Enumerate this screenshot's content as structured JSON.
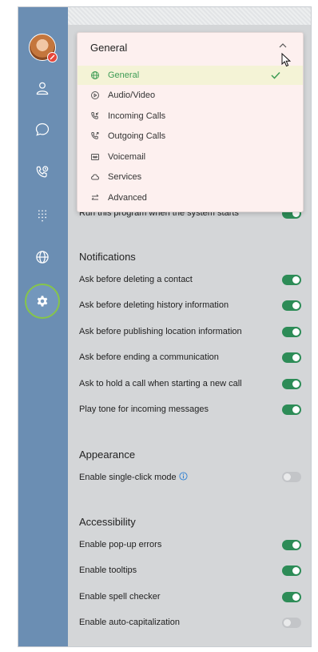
{
  "colors": {
    "sidebar": "#6b8eb3",
    "accent_green": "#2d8c57",
    "selected_text": "#3e9c55",
    "dropdown_bg": "#fdf0ef",
    "status_red": "#e5473b"
  },
  "sidebar": {
    "icons": [
      "contacts-icon",
      "chat-icon",
      "call-history-icon",
      "dialpad-icon",
      "globe-icon",
      "gear-icon"
    ]
  },
  "dropdown": {
    "selected": "General",
    "options": [
      {
        "label": "General",
        "icon": "globe-icon",
        "selected": true
      },
      {
        "label": "Audio/Video",
        "icon": "play-circle-icon",
        "selected": false
      },
      {
        "label": "Incoming Calls",
        "icon": "incoming-call-icon",
        "selected": false
      },
      {
        "label": "Outgoing Calls",
        "icon": "outgoing-call-icon",
        "selected": false
      },
      {
        "label": "Voicemail",
        "icon": "voicemail-icon",
        "selected": false
      },
      {
        "label": "Services",
        "icon": "cloud-icon",
        "selected": false
      },
      {
        "label": "Advanced",
        "icon": "arrows-icon",
        "selected": false
      }
    ]
  },
  "general": {
    "startup_label": "Run this program when the system starts",
    "startup_on": true
  },
  "notifications": {
    "title": "Notifications",
    "items": [
      {
        "label": "Ask before deleting a contact",
        "on": true
      },
      {
        "label": "Ask before deleting history information",
        "on": true
      },
      {
        "label": "Ask before publishing location information",
        "on": true
      },
      {
        "label": "Ask before ending a communication",
        "on": true
      },
      {
        "label": "Ask to hold a call when starting a new call",
        "on": true
      },
      {
        "label": "Play tone for incoming messages",
        "on": true
      }
    ]
  },
  "appearance": {
    "title": "Appearance",
    "items": [
      {
        "label": "Enable single-click mode",
        "on": false
      }
    ]
  },
  "accessibility": {
    "title": "Accessibility",
    "items": [
      {
        "label": "Enable pop-up errors",
        "on": true
      },
      {
        "label": "Enable tooltips",
        "on": true
      },
      {
        "label": "Enable spell checker",
        "on": true
      },
      {
        "label": "Enable auto-capitalization",
        "on": false
      }
    ]
  }
}
